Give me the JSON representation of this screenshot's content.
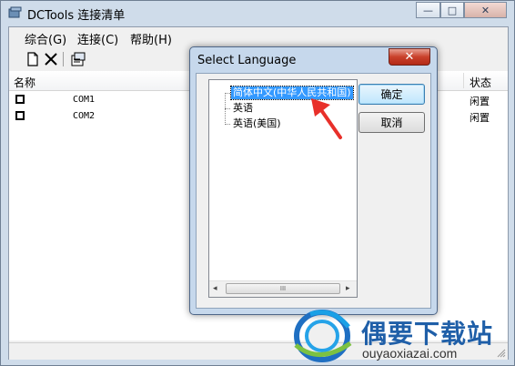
{
  "window": {
    "title": "DCTools 连接清单",
    "min_glyph": "—",
    "max_glyph": "□",
    "close_glyph": "✕"
  },
  "menu": {
    "items": [
      {
        "label": "综合(G)"
      },
      {
        "label": "连接(C)"
      },
      {
        "label": "帮助(H)"
      }
    ]
  },
  "toolbar": {
    "buttons": [
      {
        "icon": "new-document-icon"
      },
      {
        "icon": "delete-x-icon"
      },
      {
        "icon": "properties-icon"
      }
    ]
  },
  "list": {
    "columns": {
      "name": "名称",
      "status": "状态"
    },
    "rows": [
      {
        "name": "COM1",
        "status": "闲置",
        "checked": false
      },
      {
        "name": "COM2",
        "status": "闲置",
        "checked": false
      }
    ]
  },
  "dialog": {
    "title": "Select Language",
    "close_glyph": "✕",
    "languages": [
      {
        "label": "简体中文(中华人民共和国)",
        "selected": true
      },
      {
        "label": "英语",
        "selected": false
      },
      {
        "label": "英语(美国)",
        "selected": false
      }
    ],
    "ok_label": "确定",
    "cancel_label": "取消",
    "scroll_left": "◂",
    "scroll_right": "▸",
    "scroll_grip": "III"
  },
  "watermark": {
    "name": "偶要下载站",
    "url": "ouyaoxiazai.com"
  },
  "colors": {
    "selection": "#3399ff",
    "annotation_arrow": "#e8302a",
    "watermark_blue": "#1f5fa8"
  }
}
